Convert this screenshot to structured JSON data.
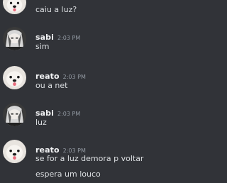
{
  "messages": [
    {
      "user": "",
      "time": "",
      "avatar": "dog-avatar",
      "lines": [
        "caiu a luz?"
      ]
    },
    {
      "user": "sabi",
      "time": "2:03 PM",
      "avatar": "anime-avatar",
      "lines": [
        "sim"
      ]
    },
    {
      "user": "reato",
      "time": "2:03 PM",
      "avatar": "dog-avatar",
      "lines": [
        "ou a net"
      ]
    },
    {
      "user": "sabi",
      "time": "2:03 PM",
      "avatar": "anime-avatar",
      "lines": [
        "luz"
      ]
    },
    {
      "user": "reato",
      "time": "2:03 PM",
      "avatar": "dog-avatar",
      "lines": [
        "se for a luz demora p voltar",
        "espera um louco"
      ]
    }
  ],
  "colors": {
    "background": "#313338",
    "username": "#f2f3f5",
    "timestamp": "#949ba4",
    "text": "#dbdee1"
  }
}
